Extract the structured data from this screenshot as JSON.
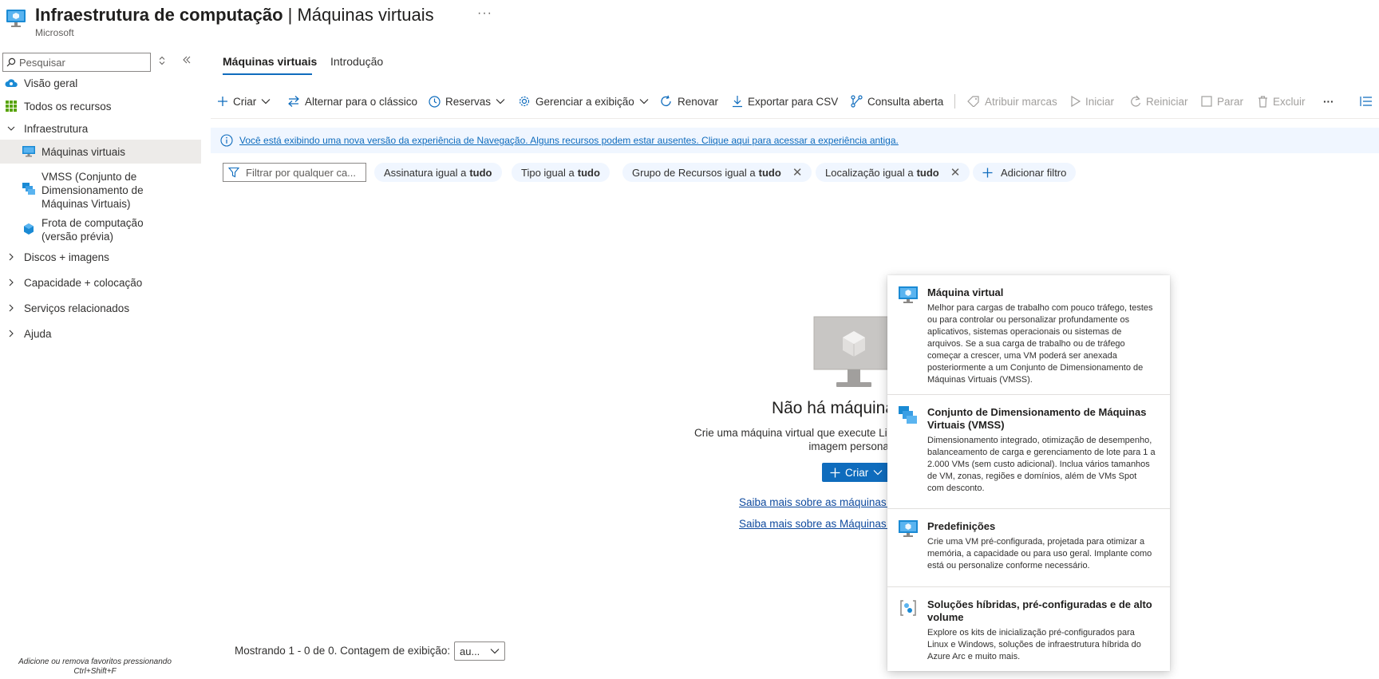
{
  "header": {
    "title_bold": "Infraestrutura de computação",
    "title_separator": " | ",
    "title_rest": "Máquinas virtuais",
    "subtitle": "Microsoft",
    "more": "···"
  },
  "sidebar": {
    "search_placeholder": "Pesquisar",
    "items": [
      {
        "label": "Visão geral"
      },
      {
        "label": "Todos os recursos"
      },
      {
        "label": "Infraestrutura"
      },
      {
        "label": "Máquinas virtuais"
      },
      {
        "label": "VMSS (Conjunto de Dimensionamento de Máquinas Virtuais)"
      },
      {
        "label": "Frota de computação (versão prévia)"
      },
      {
        "label": "Discos + imagens"
      },
      {
        "label": "Capacidade + colocação"
      },
      {
        "label": "Serviços relacionados"
      },
      {
        "label": "Ajuda"
      }
    ],
    "favorites_hint": "Adicione ou remova favoritos pressionando Ctrl+Shift+F"
  },
  "tabs": [
    {
      "label": "Máquinas virtuais"
    },
    {
      "label": "Introdução"
    }
  ],
  "toolbar": {
    "create": "Criar",
    "switch_classic": "Alternar para o clássico",
    "reservations": "Reservas",
    "manage_view": "Gerenciar a exibição",
    "refresh": "Renovar",
    "export_csv": "Exportar para CSV",
    "open_query": "Consulta aberta",
    "assign_tags": "Atribuir marcas",
    "start": "Iniciar",
    "restart": "Reiniciar",
    "stop": "Parar",
    "delete": "Excluir",
    "more": "···"
  },
  "info_bar": {
    "text": "Você está exibindo uma nova versão da experiência de Navegação. Alguns recursos podem estar ausentes. Clique aqui para acessar a experiência antiga."
  },
  "filters": {
    "placeholder": "Filtrar por qualquer ca...",
    "pills": [
      {
        "prefix": "Assinatura igual a ",
        "value": "tudo"
      },
      {
        "prefix": "Tipo igual a ",
        "value": "tudo"
      },
      {
        "prefix": "Grupo de Recursos igual a ",
        "value": "tudo"
      },
      {
        "prefix": "Localização igual a ",
        "value": "tudo"
      }
    ],
    "add_filter": "Adicionar filtro"
  },
  "empty_state": {
    "title": "Não há máquinas virtu",
    "desc_line1": "Crie uma máquina virtual que execute Linux ou Windows. Selecion",
    "desc_line2": "imagem personaliz",
    "create_button": "Criar",
    "learn_more_1": "Saiba mais sobre as máquinas v",
    "learn_more_2": "Saiba mais sobre as Máquinas V"
  },
  "footer": {
    "paging_text": "Mostrando 1 - 0 de 0. Contagem de exibição:",
    "count_value": "au..."
  },
  "create_menu": {
    "items": [
      {
        "title": "Máquina virtual",
        "desc": "Melhor para cargas de trabalho com pouco tráfego, testes ou para controlar ou personalizar profundamente os aplicativos, sistemas operacionais ou sistemas de arquivos. Se a sua carga de trabalho ou de tráfego começar a crescer, uma VM poderá ser anexada posteriormente a um Conjunto de Dimensionamento de Máquinas Virtuais (VMSS)."
      },
      {
        "title": "Conjunto de Dimensionamento de Máquinas Virtuais (VMSS)",
        "desc": "Dimensionamento integrado, otimização de desempenho, balanceamento de carga e gerenciamento de lote para 1 a 2.000 VMs (sem custo adicional). Inclua vários tamanhos de VM, zonas, regiões e domínios, além de VMs Spot com desconto."
      },
      {
        "title": "Predefinições",
        "desc": "Crie uma VM pré-configurada, projetada para otimizar a memória, a capacidade ou para uso geral. Implante como está ou personalize conforme necessário."
      },
      {
        "title": "Soluções híbridas, pré-configuradas e de alto volume",
        "desc": "Explore os kits de inicialização pré-configurados para Linux e Windows, soluções de infraestrutura híbrida do Azure Arc e muito mais."
      }
    ]
  }
}
